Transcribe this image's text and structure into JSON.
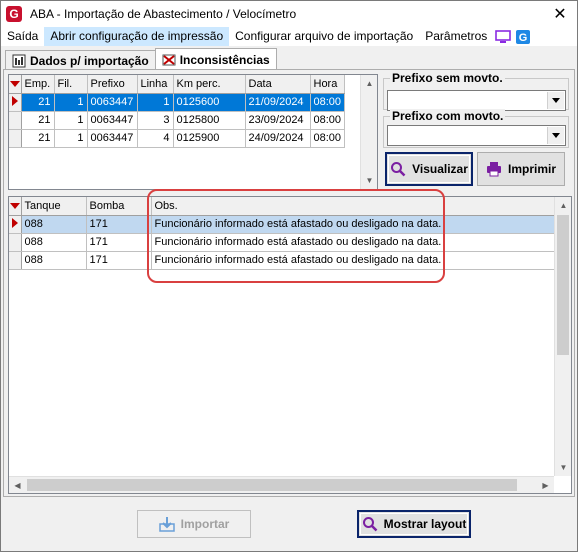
{
  "window": {
    "title": "ABA - Importação de Abastecimento / Velocímetro",
    "app_icon": "G"
  },
  "menu": {
    "items": [
      "Saída",
      "Abrir configuração de impressão",
      "Configurar arquivo de importação",
      "Parâmetros"
    ]
  },
  "tabs": [
    {
      "label": "Dados p/ importação",
      "icon": "data-icon"
    },
    {
      "label": "Inconsistências",
      "icon": "inconsistency-icon"
    }
  ],
  "top_grid": {
    "columns": [
      "Emp.",
      "Fil.",
      "Prefixo",
      "Linha",
      "Km perc.",
      "Data",
      "Hora"
    ],
    "rows": [
      [
        "21",
        "1",
        "0063447",
        "1",
        "0125600",
        "21/09/2024",
        "08:00"
      ],
      [
        "21",
        "1",
        "0063447",
        "3",
        "0125800",
        "23/09/2024",
        "08:00"
      ],
      [
        "21",
        "1",
        "0063447",
        "4",
        "0125900",
        "24/09/2024",
        "08:00"
      ]
    ]
  },
  "filters": {
    "prefix_without_movement_label": "Prefixo sem movto.",
    "prefix_without_movement_value": "",
    "prefix_with_movement_label": "Prefixo com movto.",
    "prefix_with_movement_value": "",
    "view_button": "Visualizar",
    "print_button": "Imprimir"
  },
  "bottom_grid": {
    "columns": [
      "Tanque",
      "Bomba",
      "Obs."
    ],
    "rows": [
      [
        "088",
        "171",
        "Funcionário informado está afastado ou desligado na data."
      ],
      [
        "088",
        "171",
        "Funcionário informado está afastado ou desligado na data."
      ],
      [
        "088",
        "171",
        "Funcionário informado está afastado ou desligado na data."
      ]
    ]
  },
  "footer": {
    "import_button": "Importar",
    "show_layout_button": "Mostrar layout"
  },
  "colors": {
    "accent": "#0078d7",
    "highlight": "#d94040",
    "brand": "#c8102e"
  }
}
